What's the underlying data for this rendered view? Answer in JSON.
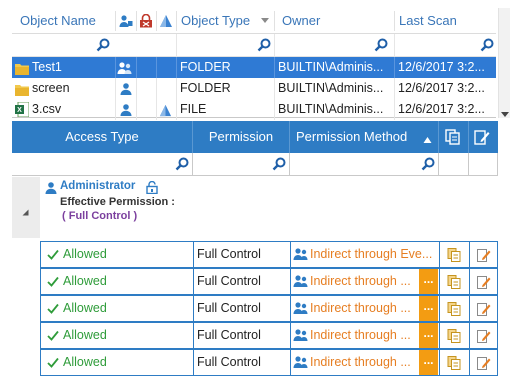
{
  "objects": {
    "columns": {
      "name": "Object Name",
      "type": "Object Type",
      "owner": "Owner",
      "scan": "Last Scan"
    },
    "rows": [
      {
        "name": "Test1",
        "type": "FOLDER",
        "owner": "BUILTIN\\Adminis...",
        "scan": "12/6/2017 3:2...",
        "icon": "folder-icon",
        "selected": true
      },
      {
        "name": "screen",
        "type": "FOLDER",
        "owner": "BUILTIN\\Adminis...",
        "scan": "12/6/2017 3:2...",
        "icon": "folder-icon",
        "selected": false
      },
      {
        "name": "3.csv",
        "type": "FILE",
        "owner": "BUILTIN\\Adminis...",
        "scan": "12/6/2017 3:2...",
        "icon": "excel-file-icon",
        "selected": false
      }
    ]
  },
  "permissions": {
    "columns": {
      "access": "Access Type",
      "permission": "Permission",
      "method": "Permission Method"
    },
    "group": {
      "user": "Administrator",
      "effective_label": "Effective Permission :",
      "effective_value": "( Full Control )"
    },
    "rows": [
      {
        "access": "Allowed",
        "permission": "Full Control",
        "method": "Indirect through Eve..."
      },
      {
        "access": "Allowed",
        "permission": "Full Control",
        "method": "Indirect through ..."
      },
      {
        "access": "Allowed",
        "permission": "Full Control",
        "method": "Indirect through ..."
      },
      {
        "access": "Allowed",
        "permission": "Full Control",
        "method": "Indirect through ..."
      },
      {
        "access": "Allowed",
        "permission": "Full Control",
        "method": "Indirect through ..."
      }
    ],
    "more_button": "..."
  },
  "colors": {
    "accent": "#2e7cc4",
    "selected_row": "#2f7ad4",
    "allowed": "#2f9c3a",
    "method": "#e67e22",
    "dots_button": "#f39c12"
  }
}
